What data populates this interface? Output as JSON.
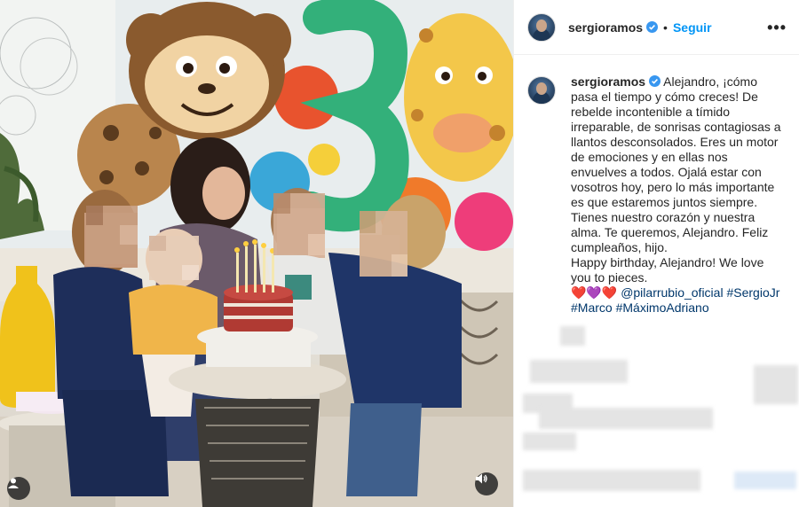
{
  "post": {
    "author": "sergioramos",
    "follow_label": "Seguir",
    "more_label": "•••",
    "caption_line1": "Alejandro, ¡cómo pasa el tiempo y cómo creces! De rebelde incontenible a tímido irreparable, de sonrisas contagiosas a llantos desconsolados. Eres un motor de emociones y en ellas nos envuelves a todos. Ojalá estar con vosotros hoy, pero lo más importante es que estaremos juntos siempre. Tienes nuestro corazón y nuestra alma. Te queremos, Alejandro. Feliz cumpleaños, hijo.",
    "caption_line2": "Happy birthday, Alejandro! We love you to pieces.",
    "hearts": "❤️💜❤️",
    "mention": "@pilarrubio_oficial",
    "tags": [
      "#SergioJr",
      "#Marco",
      "#MáximoAdriano"
    ]
  },
  "icons": {
    "verified": "verified-badge-icon",
    "user_tag": "user-tag-icon",
    "mute": "volume-icon",
    "more": "more-options-icon"
  },
  "colors": {
    "follow": "#0095f6",
    "link": "#00376b",
    "verified": "#3897f0"
  }
}
